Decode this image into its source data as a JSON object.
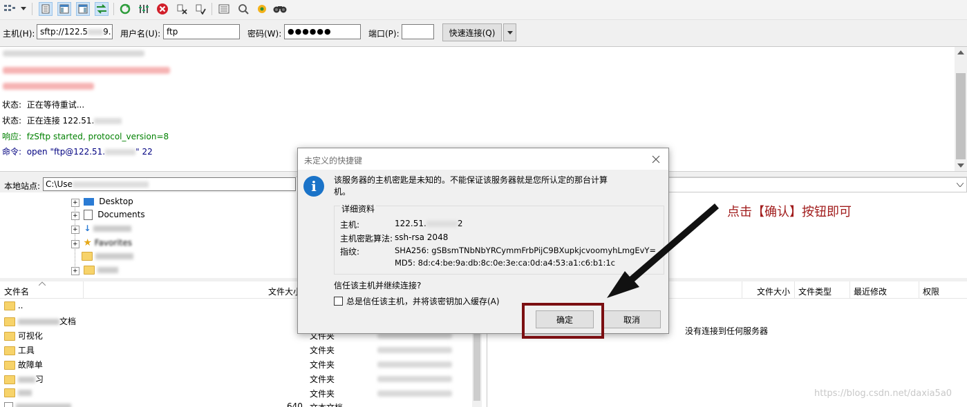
{
  "quickconnect": {
    "host_label": "主机(H):",
    "host_value": "sftp://122.5",
    "host_value_tail": "9.1",
    "user_label": "用户名(U):",
    "user_value": "ftp",
    "pass_label": "密码(W):",
    "pass_value": "●●●●●●",
    "port_label": "端口(P):",
    "port_value": "",
    "connect_button": "快速连接(Q)"
  },
  "log": {
    "lines": [
      {
        "prefix": "状态:",
        "text": "正在等待重试..."
      },
      {
        "prefix": "状态:",
        "text": "正在连接 122.51."
      },
      {
        "prefix": "响应:",
        "text": "fzSftp started, protocol_version=8"
      },
      {
        "prefix": "命令:",
        "text": "open \"ftp@122.51."
      },
      {
        "text_tail": "\" 22"
      }
    ]
  },
  "local": {
    "site_label": "本地站点:",
    "path_value": "C:\\Use",
    "tree": [
      "Desktop",
      "Documents",
      "",
      "Favorites",
      "",
      ""
    ],
    "columns": {
      "name": "文件名",
      "size": "文件大小"
    },
    "files": [
      {
        "name": "..",
        "type": ""
      },
      {
        "name": "文档",
        "type": ""
      },
      {
        "name": "可视化",
        "type": "文件夹"
      },
      {
        "name": "工具",
        "type": "文件夹"
      },
      {
        "name": "故障单",
        "type": "文件夹"
      },
      {
        "name": "习",
        "type": "文件夹"
      },
      {
        "name": "",
        "type": "文件夹"
      },
      {
        "name": "",
        "size": "640",
        "type": "文本文档"
      }
    ]
  },
  "remote": {
    "columns": {
      "size": "文件大小",
      "type": "文件类型",
      "modified": "最近修改",
      "perm": "权限"
    },
    "empty_text": "没有连接到任何服务器"
  },
  "dialog": {
    "title": "未定义的快捷键",
    "message_line1": "该服务器的主机密匙是未知的。不能保证该服务器就是您所认定的那台计算",
    "message_line2": "机。",
    "details_legend": "详细资料",
    "host_label": "主机:",
    "host_value": "122.51.",
    "host_value_tail": "2",
    "algo_label": "主机密匙算法:",
    "algo_value": "ssh-rsa 2048",
    "fingerprint_label": "指纹:",
    "sha256": "SHA256: gSBsmTNbNbYRCymmFrbPijC9BXupkjcvoomyhLmgEvY=",
    "md5": "MD5: 8d:c4:be:9a:db:8c:0e:3e:ca:0d:a4:53:a1:c6:b1:1c",
    "trust_question": "信任该主机并继续连接?",
    "checkbox_label": "总是信任该主机，并将该密钥加入缓存(A)",
    "ok_button": "确定",
    "cancel_button": "取消"
  },
  "annotation": "点击【确认】按钮即可",
  "watermark": "https://blog.csdn.net/daxia5a0",
  "colors": {
    "annotation_red": "#7b0f12",
    "log_green": "#008000",
    "log_blue": "#000080"
  }
}
